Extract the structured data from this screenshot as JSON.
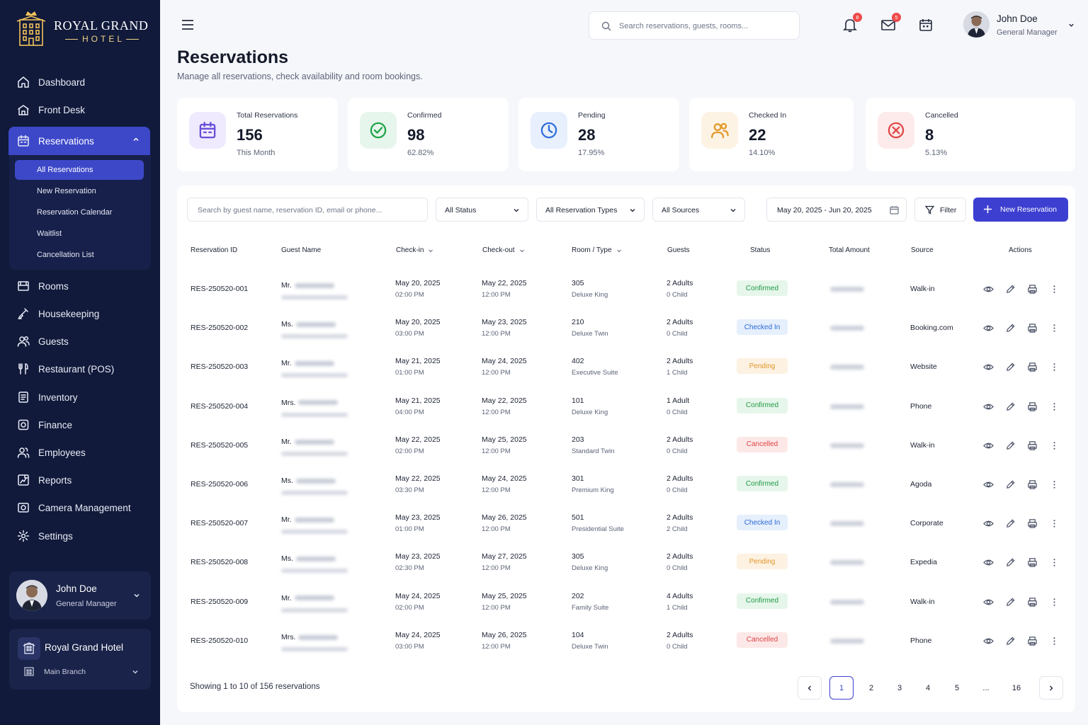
{
  "brand": {
    "name": "ROYAL GRAND",
    "sub": "HOTEL"
  },
  "sidebar": {
    "items": [
      {
        "label": "Dashboard",
        "icon": "home-icon"
      },
      {
        "label": "Front Desk",
        "icon": "front-desk-icon"
      },
      {
        "label": "Reservations",
        "icon": "calendar-icon"
      },
      {
        "label": "Rooms",
        "icon": "bed-icon"
      },
      {
        "label": "Housekeeping",
        "icon": "broom-icon"
      },
      {
        "label": "Guests",
        "icon": "users-icon"
      },
      {
        "label": "Restaurant (POS)",
        "icon": "utensils-icon"
      },
      {
        "label": "Inventory",
        "icon": "inventory-icon"
      },
      {
        "label": "Finance",
        "icon": "finance-icon"
      },
      {
        "label": "Employees",
        "icon": "employees-icon"
      },
      {
        "label": "Reports",
        "icon": "reports-icon"
      },
      {
        "label": "Camera Management",
        "icon": "camera-icon"
      },
      {
        "label": "Settings",
        "icon": "gear-icon"
      }
    ],
    "submenu": [
      "All Reservations",
      "New Reservation",
      "Reservation Calendar",
      "Waitlist",
      "Cancellation List"
    ],
    "profile": {
      "name": "John Doe",
      "role": "General Manager"
    },
    "hotel": {
      "name": "Royal Grand Hotel",
      "branch": "Main Branch"
    }
  },
  "topbar": {
    "search_placeholder": "Search reservations, guests, rooms...",
    "notifications_count": "8",
    "messages_count": "5",
    "user": {
      "name": "John Doe",
      "role": "General Manager"
    }
  },
  "page": {
    "title": "Reservations",
    "subtitle": "Manage all reservations, check availability and room bookings."
  },
  "stats": [
    {
      "label": "Total Reservations",
      "value": "156",
      "sub": "This Month",
      "icon": "calendar-icon",
      "color": "#6a4fd8",
      "bg": "#efeafd"
    },
    {
      "label": "Confirmed",
      "value": "98",
      "sub": "62.82%",
      "icon": "check-circle-icon",
      "color": "#23a34a",
      "bg": "#e7f6ec"
    },
    {
      "label": "Pending",
      "value": "28",
      "sub": "17.95%",
      "icon": "clock-icon",
      "color": "#2f6fdc",
      "bg": "#e8f0fd"
    },
    {
      "label": "Checked In",
      "value": "22",
      "sub": "14.10%",
      "icon": "users-icon",
      "color": "#e39a2c",
      "bg": "#fdf3e4"
    },
    {
      "label": "Cancelled",
      "value": "8",
      "sub": "5.13%",
      "icon": "x-circle-icon",
      "color": "#e04848",
      "bg": "#fdeaea"
    }
  ],
  "filters": {
    "search_placeholder": "Search by guest name, reservation ID, email or phone...",
    "status": "All Status",
    "types": "All Reservation Types",
    "sources": "All Sources",
    "date_range": "May 20, 2025 - Jun 20, 2025",
    "filter_label": "Filter",
    "new_label": "New Reservation"
  },
  "table": {
    "columns": [
      "Reservation ID",
      "Guest Name",
      "Check-in",
      "Check-out",
      "Room / Type",
      "Guests",
      "Status",
      "Total Amount",
      "Source",
      "Actions"
    ],
    "rows": [
      {
        "id": "RES-250520-001",
        "title": "Mr.",
        "in_date": "May 20, 2025",
        "in_time": "02:00 PM",
        "out_date": "May 22, 2025",
        "out_time": "12:00 PM",
        "room": "305",
        "type": "Deluxe King",
        "adults": "2 Adults",
        "children": "0 Child",
        "status": "Confirmed",
        "source": "Walk-in"
      },
      {
        "id": "RES-250520-002",
        "title": "Ms.",
        "in_date": "May 20, 2025",
        "in_time": "03:00 PM",
        "out_date": "May 23, 2025",
        "out_time": "12:00 PM",
        "room": "210",
        "type": "Deluxe Twin",
        "adults": "2 Adults",
        "children": "0 Child",
        "status": "Checked In",
        "source": "Booking.com"
      },
      {
        "id": "RES-250520-003",
        "title": "Mr.",
        "in_date": "May 21, 2025",
        "in_time": "01:00 PM",
        "out_date": "May 24, 2025",
        "out_time": "12:00 PM",
        "room": "402",
        "type": "Executive Suite",
        "adults": "2 Adults",
        "children": "1 Child",
        "status": "Pending",
        "source": "Website"
      },
      {
        "id": "RES-250520-004",
        "title": "Mrs.",
        "in_date": "May 21, 2025",
        "in_time": "04:00 PM",
        "out_date": "May 22, 2025",
        "out_time": "12:00 PM",
        "room": "101",
        "type": "Deluxe King",
        "adults": "1 Adult",
        "children": "0 Child",
        "status": "Confirmed",
        "source": "Phone"
      },
      {
        "id": "RES-250520-005",
        "title": "Mr.",
        "in_date": "May 22, 2025",
        "in_time": "02:00 PM",
        "out_date": "May 25, 2025",
        "out_time": "12:00 PM",
        "room": "203",
        "type": "Standard Twin",
        "adults": "2 Adults",
        "children": "0 Child",
        "status": "Cancelled",
        "source": "Walk-in"
      },
      {
        "id": "RES-250520-006",
        "title": "Ms.",
        "in_date": "May 22, 2025",
        "in_time": "03:30 PM",
        "out_date": "May 24, 2025",
        "out_time": "12:00 PM",
        "room": "301",
        "type": "Premium King",
        "adults": "2 Adults",
        "children": "0 Child",
        "status": "Confirmed",
        "source": "Agoda"
      },
      {
        "id": "RES-250520-007",
        "title": "Mr.",
        "in_date": "May 23, 2025",
        "in_time": "01:00 PM",
        "out_date": "May 26, 2025",
        "out_time": "12:00 PM",
        "room": "501",
        "type": "Presidential Suite",
        "adults": "2 Adults",
        "children": "2 Child",
        "status": "Checked In",
        "source": "Corporate"
      },
      {
        "id": "RES-250520-008",
        "title": "Ms.",
        "in_date": "May 23, 2025",
        "in_time": "02:30 PM",
        "out_date": "May 27, 2025",
        "out_time": "12:00 PM",
        "room": "305",
        "type": "Deluxe King",
        "adults": "2 Adults",
        "children": "0 Child",
        "status": "Pending",
        "source": "Expedia"
      },
      {
        "id": "RES-250520-009",
        "title": "Mr.",
        "in_date": "May 24, 2025",
        "in_time": "02:00 PM",
        "out_date": "May 25, 2025",
        "out_time": "12:00 PM",
        "room": "202",
        "type": "Family Suite",
        "adults": "4 Adults",
        "children": "1 Child",
        "status": "Confirmed",
        "source": "Walk-in"
      },
      {
        "id": "RES-250520-010",
        "title": "Mrs.",
        "in_date": "May 24, 2025",
        "in_time": "03:00 PM",
        "out_date": "May 26, 2025",
        "out_time": "12:00 PM",
        "room": "104",
        "type": "Deluxe Twin",
        "adults": "2 Adults",
        "children": "0 Child",
        "status": "Cancelled",
        "source": "Phone"
      }
    ]
  },
  "status_colors": {
    "Confirmed": {
      "fg": "#1f9a44",
      "bg": "#e6f6eb"
    },
    "Checked In": {
      "fg": "#2a6ad8",
      "bg": "#e6effc"
    },
    "Pending": {
      "fg": "#e1952a",
      "bg": "#fdf2e2"
    },
    "Cancelled": {
      "fg": "#df4444",
      "bg": "#fde8e8"
    }
  },
  "pagination": {
    "summary": "Showing 1 to 10 of 156 reservations",
    "pages": [
      "1",
      "2",
      "3",
      "4",
      "5",
      "...",
      "16"
    ],
    "current": "1"
  }
}
